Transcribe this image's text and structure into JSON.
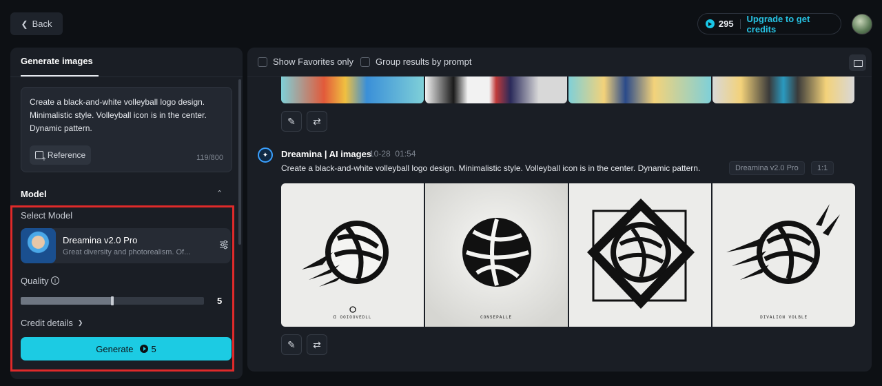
{
  "topbar": {
    "back_label": "Back",
    "credits": "295",
    "upgrade_label": "Upgrade to get credits"
  },
  "left": {
    "tab_label": "Generate images",
    "prompt": "Create a black-and-white volleyball logo design. Minimalistic style. Volleyball icon is in the center. Dynamic pattern.",
    "reference_label": "Reference",
    "char_count": "119/800",
    "model_section_label": "Model",
    "select_model_label": "Select Model",
    "model_name": "Dreamina v2.0 Pro",
    "model_desc": "Great diversity and photorealism. Of...",
    "quality_label": "Quality",
    "quality_value": "5",
    "quality_fraction": 0.5,
    "credit_details_label": "Credit details",
    "generate_label": "Generate",
    "generate_cost": "5"
  },
  "right": {
    "filter_favorites": "Show Favorites only",
    "filter_group": "Group results by prompt",
    "result_author": "Dreamina | AI images",
    "result_date": "10-28",
    "result_clock": "01:54",
    "result_prompt": "Create a black-and-white volleyball logo design. Minimalistic style. Volleyball icon is in the center. Dynamic pattern.",
    "tag_model": "Dreamina v2.0 Pro",
    "tag_ratio": "1:1",
    "image_captions": [
      "ᗡ OOIOOVEDLL",
      "CONSEPALLE",
      "",
      "DIVALION VOLBLE"
    ]
  },
  "colors": {
    "accent": "#1ccbe3",
    "link": "#27c3e3",
    "highlight": "#e02a2a",
    "panel": "#1a1e25",
    "background": "#0d1014"
  }
}
